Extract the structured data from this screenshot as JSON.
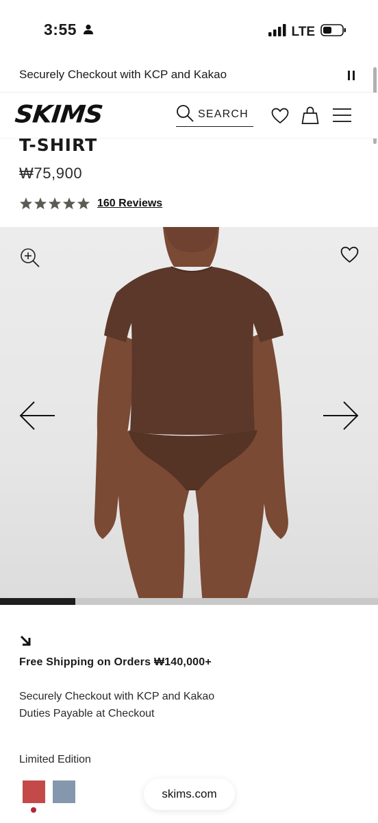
{
  "status_bar": {
    "time": "3:55",
    "network": "LTE"
  },
  "announcement": {
    "text": "Securely Checkout with KCP and Kakao"
  },
  "header": {
    "logo": "SKIMS",
    "search_label": "SEARCH"
  },
  "product": {
    "title": "T-SHIRT",
    "price": "₩75,900",
    "rating": 5,
    "reviews_label": "160 Reviews"
  },
  "gallery": {
    "color_brown": "#5e3b2c",
    "progress": 0.2
  },
  "info": {
    "shipping": "Free Shipping on Orders ₩140,000+",
    "secure": "Securely Checkout with KCP and Kakao",
    "duties": "Duties Payable at Checkout"
  },
  "edition": {
    "label": "Limited Edition",
    "swatches": [
      {
        "color": "#c44a4a"
      },
      {
        "color": "#8497ad"
      }
    ]
  },
  "browser": {
    "url": "skims.com"
  }
}
